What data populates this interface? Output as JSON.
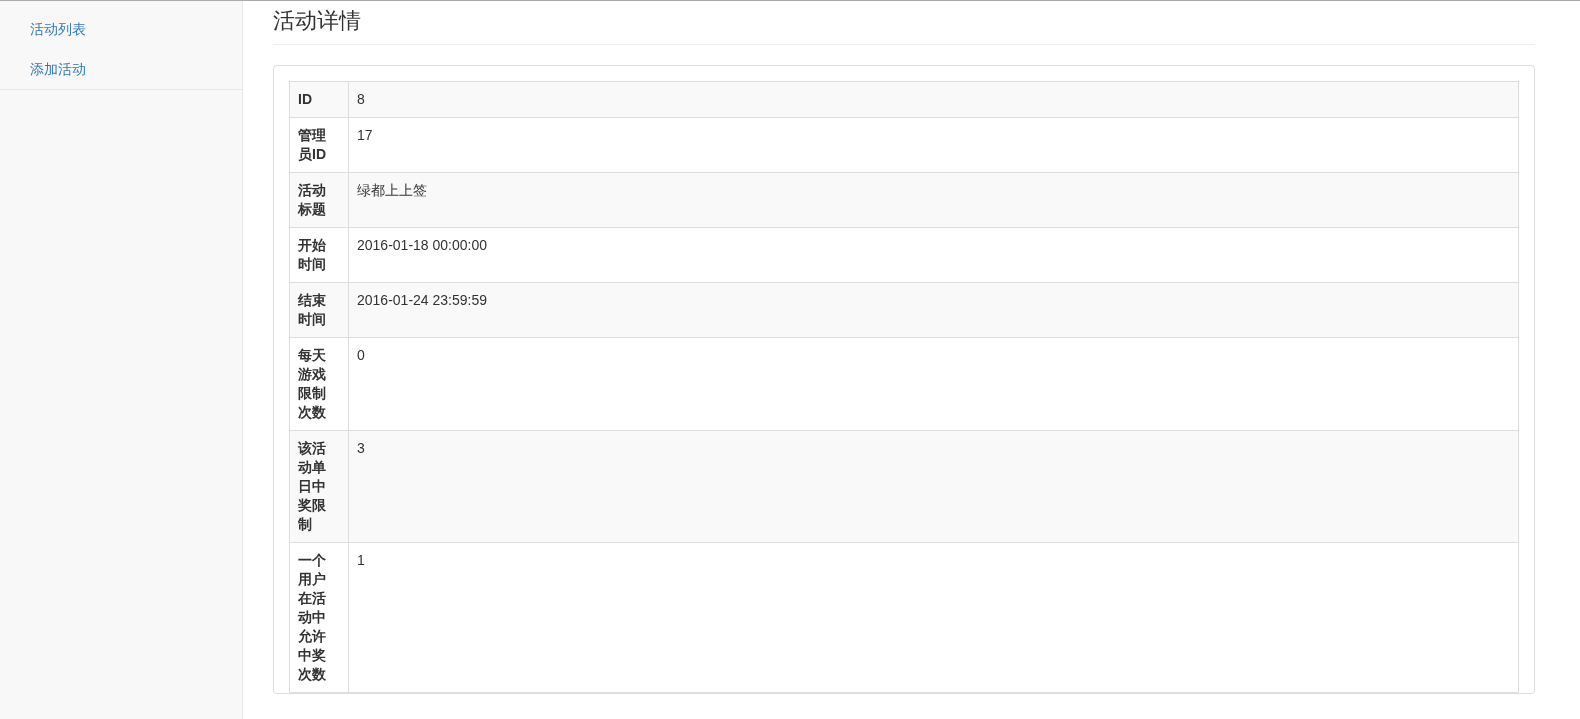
{
  "sidebar": {
    "items": [
      {
        "label": "活动列表"
      },
      {
        "label": "添加活动"
      }
    ]
  },
  "page_title": "活动详情",
  "details": {
    "rows": [
      {
        "label": "ID",
        "value": "8"
      },
      {
        "label": "管理员ID",
        "value": "17"
      },
      {
        "label": "活动标题",
        "value": "绿都上上签"
      },
      {
        "label": "开始时间",
        "value": "2016-01-18 00:00:00"
      },
      {
        "label": "结束时间",
        "value": "2016-01-24 23:59:59"
      },
      {
        "label": "每天游戏限制次数",
        "value": "0"
      },
      {
        "label": "该活动单日中奖限制",
        "value": "3"
      },
      {
        "label": "一个用户在活动中允许中奖次数",
        "value": "1"
      }
    ]
  }
}
